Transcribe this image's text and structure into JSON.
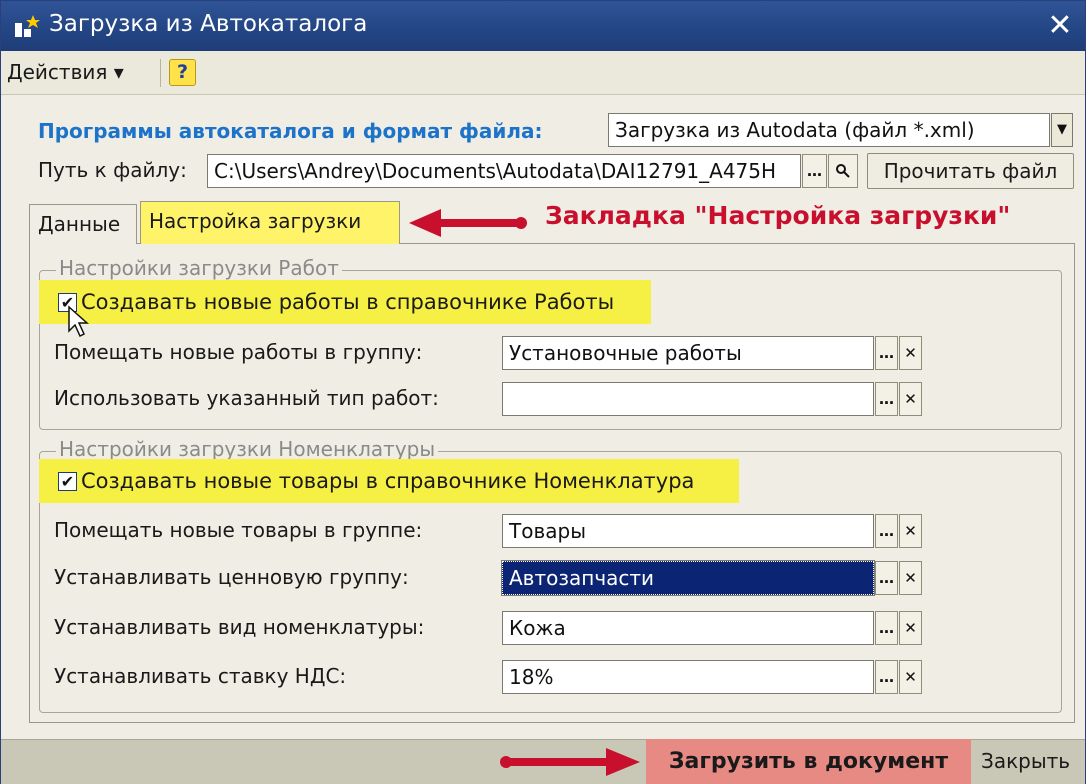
{
  "window": {
    "title": "Загрузка из Автокаталога",
    "close_label": "✕",
    "icon": "app-icon"
  },
  "menu": {
    "actions_label": "Действия ▾",
    "help_label": "?"
  },
  "header": {
    "programs_label": "Программы автокаталога и формат файла:",
    "programs_value": "Загрузка из Autodata (файл *.xml)",
    "path_label": "Путь к файлу:",
    "path_value": "C:\\Users\\Andrey\\Documents\\Autodata\\DAI12791_A475H",
    "read_button": "Прочитать файл"
  },
  "tabs": [
    {
      "label": "Данные",
      "active": false
    },
    {
      "label": "Настройка загрузки",
      "active": true
    }
  ],
  "annotation": "Закладка \"Настройка загрузки\"",
  "works_group": {
    "title": "Настройки загрузки Работ",
    "checkbox_label": "Создавать новые работы в справочнике Работы",
    "checked": true,
    "fields": [
      {
        "label": "Помещать новые работы в группу:",
        "value": "Установочные работы"
      },
      {
        "label": "Использовать указанный тип работ:",
        "value": ""
      }
    ]
  },
  "items_group": {
    "title": "Настройки загрузки Номенклатуры",
    "checkbox_label": "Создавать новые товары в справочнике Номенклатура",
    "checked": true,
    "fields": [
      {
        "label": "Помещать новые товары в группе:",
        "value": "Товары"
      },
      {
        "label": "Устанавливать ценновую группу:",
        "value": "Автозапчасти"
      },
      {
        "label": "Устанавливать вид номенклатуры:",
        "value": "Кожа"
      },
      {
        "label": "Устанавливать ставку НДС:",
        "value": "18%"
      }
    ]
  },
  "footer": {
    "load_button": "Загрузить в документ",
    "close_button": "Закрыть"
  },
  "colors": {
    "highlight": "#f6f045",
    "annotation": "#c8102e",
    "load_button_bg": "#e88a84",
    "title_bar": "#244685"
  }
}
